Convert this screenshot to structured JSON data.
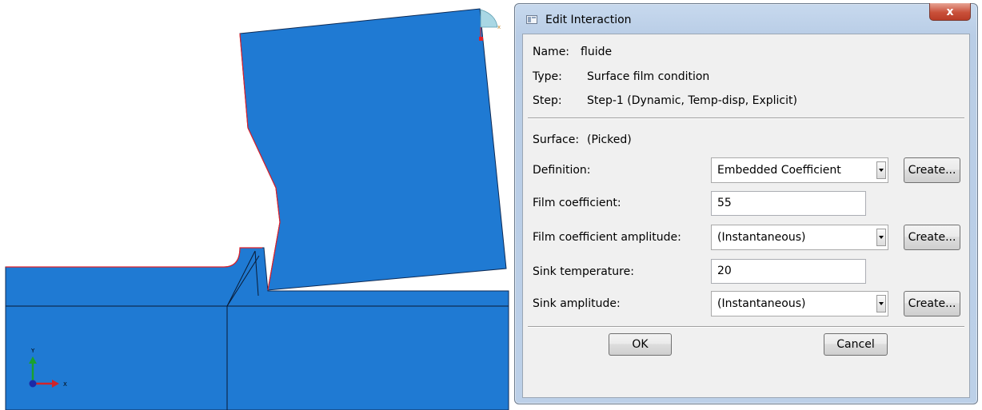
{
  "dialog": {
    "title": "Edit Interaction",
    "close_label": "x",
    "name_label": "Name:",
    "name_value": "fluide",
    "type_label": "Type:",
    "type_value": "Surface film condition",
    "step_label": "Step:",
    "step_value": "Step-1 (Dynamic, Temp-disp, Explicit)",
    "surface_label": "Surface:",
    "surface_value": "(Picked)",
    "fields": {
      "definition": {
        "label": "Definition:",
        "value": "Embedded Coefficient",
        "button": "Create..."
      },
      "film_coefficient": {
        "label": "Film coefficient:",
        "value": "55"
      },
      "film_coefficient_amplitude": {
        "label": "Film coefficient amplitude:",
        "value": "(Instantaneous)",
        "button": "Create..."
      },
      "sink_temperature": {
        "label": "Sink temperature:",
        "value": "20"
      },
      "sink_amplitude": {
        "label": "Sink amplitude:",
        "value": "(Instantaneous)",
        "button": "Create..."
      }
    },
    "ok_label": "OK",
    "cancel_label": "Cancel"
  },
  "viewport": {
    "axis_y_label": "Y",
    "axis_x_label": "X",
    "part_color": "#1f7ad3",
    "edge_highlight_color": "#e0202a"
  }
}
